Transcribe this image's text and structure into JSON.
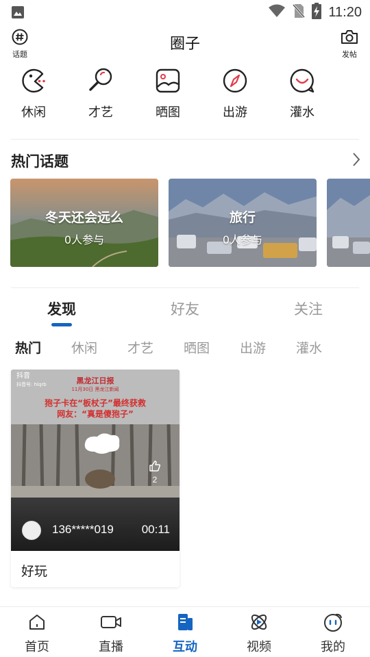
{
  "status_bar": {
    "time": "11:20"
  },
  "header": {
    "title": "圈子",
    "left_label": "话题",
    "right_label": "发帖"
  },
  "categories": [
    {
      "label": "休闲",
      "icon": "pacman-icon"
    },
    {
      "label": "才艺",
      "icon": "magnifier-icon"
    },
    {
      "label": "晒图",
      "icon": "picture-icon"
    },
    {
      "label": "出游",
      "icon": "compass-icon"
    },
    {
      "label": "灌水",
      "icon": "smile-bubble-icon"
    }
  ],
  "hot_topics": {
    "title": "热门话题",
    "items": [
      {
        "title": "冬天还会远么",
        "sub": "0人参与"
      },
      {
        "title": "旅行",
        "sub": "0人参与"
      }
    ]
  },
  "tabs": [
    {
      "label": "发现"
    },
    {
      "label": "好友"
    },
    {
      "label": "关注"
    }
  ],
  "sub_tabs": [
    {
      "label": "热门"
    },
    {
      "label": "休闲"
    },
    {
      "label": "才艺"
    },
    {
      "label": "晒图"
    },
    {
      "label": "出游"
    },
    {
      "label": "灌水"
    }
  ],
  "post": {
    "caption": "好玩",
    "user": "136*****019",
    "duration": "00:11",
    "likes": "2",
    "watermark_app": "抖音",
    "watermark_id": "抖音号: hlqrb",
    "news_title": "黑龙江日报",
    "news_date": "11月30日 黑龙江新闻",
    "news_line1": "狍子卡在“板杖子”最终获救",
    "news_line2": "网友：“真是傻狍子”"
  },
  "bottom_nav": [
    {
      "label": "首页",
      "icon": "home-icon"
    },
    {
      "label": "直播",
      "icon": "video-camera-icon"
    },
    {
      "label": "互动",
      "icon": "interact-icon"
    },
    {
      "label": "视频",
      "icon": "play-orbit-icon"
    },
    {
      "label": "我的",
      "icon": "user-face-icon"
    }
  ],
  "colors": {
    "accent": "#1565c0",
    "category_icon_red": "#e23b4a",
    "muted_text": "#999999"
  }
}
